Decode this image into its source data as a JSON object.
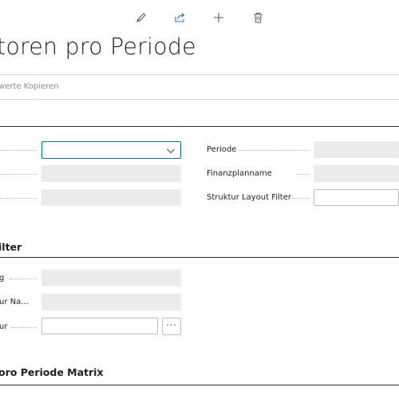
{
  "toolbar": {
    "edit_icon": "pencil-icon",
    "share_icon": "share-icon",
    "new_icon": "plus-icon",
    "delete_icon": "trash-icon"
  },
  "page": {
    "title": "toren pro Periode"
  },
  "action_bar": {
    "item_label": "werte Kopieren"
  },
  "general_section": {
    "left_fields": [
      {
        "label": "",
        "value": "",
        "type": "dropdown"
      },
      {
        "label": "",
        "value": ""
      },
      {
        "label": "",
        "value": ""
      }
    ],
    "right_fields": [
      {
        "label": "Periode",
        "value": ""
      },
      {
        "label": "Finanzplanname",
        "value": ""
      },
      {
        "label": "Struktur Layout Filter",
        "value": ""
      }
    ]
  },
  "filter_section": {
    "title": "ilter",
    "fields": [
      {
        "label": "g",
        "value": ""
      },
      {
        "label": "ur Na...",
        "value": ""
      },
      {
        "label": "ur",
        "value": "",
        "lookup_label": "···"
      }
    ]
  },
  "matrix_section": {
    "title": "oro Periode Matrix"
  },
  "colors": {
    "accent": "#00728f",
    "field_bg": "#ebebeb",
    "icon": "#5a5a5a",
    "share_icon": "#2b6fa8"
  }
}
